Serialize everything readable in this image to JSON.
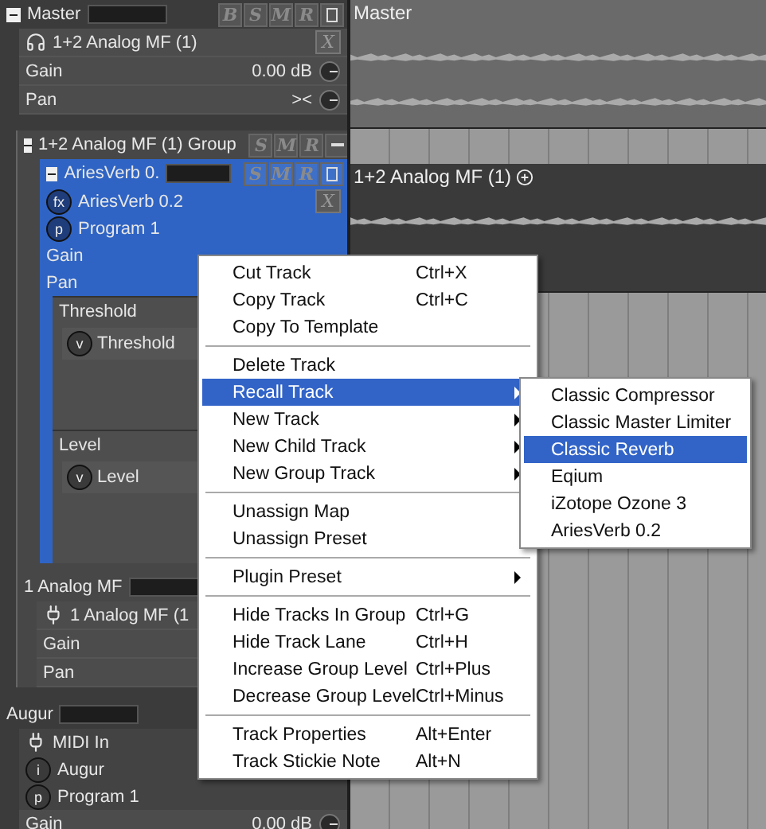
{
  "master": {
    "title": "Master",
    "buttons": [
      {
        "kind": "letter",
        "label": "B"
      },
      {
        "kind": "letter",
        "label": "S"
      },
      {
        "kind": "letter",
        "label": "M"
      },
      {
        "kind": "letter",
        "label": "R"
      },
      {
        "kind": "square"
      }
    ],
    "input": "1+2 Analog MF (1)",
    "remove": "X",
    "gain_label": "Gain",
    "gain_value": "0.00 dB",
    "pan_label": "Pan",
    "pan_value": "><"
  },
  "group": {
    "title": "1+2 Analog MF (1) Group",
    "buttons": [
      {
        "kind": "letter",
        "label": "S"
      },
      {
        "kind": "letter",
        "label": "M"
      },
      {
        "kind": "letter",
        "label": "R"
      },
      {
        "kind": "minus"
      }
    ],
    "selected_track": {
      "title": "AriesVerb 0.",
      "buttons": [
        {
          "kind": "letter",
          "label": "S"
        },
        {
          "kind": "letter",
          "label": "M"
        },
        {
          "kind": "letter",
          "label": "R"
        },
        {
          "kind": "square"
        }
      ],
      "plugin_badge": "fx",
      "plugin": "AriesVerb 0.2",
      "remove": "X",
      "program_badge": "p",
      "program": "Program 1",
      "gain_label": "Gain",
      "pan_label": "Pan",
      "params": [
        {
          "header": "Threshold",
          "badge": "v",
          "control": "Threshold"
        },
        {
          "header": "Level",
          "badge": "v",
          "control": "Level"
        }
      ]
    },
    "track": {
      "title": "1 Analog MF",
      "input": "1 Analog MF (1",
      "gain_label": "Gain",
      "pan_label": "Pan"
    }
  },
  "augur": {
    "title": "Augur",
    "input": "MIDI In",
    "instrument_badge": "i",
    "instrument": "Augur",
    "program_badge": "p",
    "program": "Program 1",
    "gain_label": "Gain",
    "gain_value": "0.00 dB"
  },
  "timeline": {
    "lanes": [
      {
        "label": "Master"
      },
      {
        "label": "1+2 Analog MF (1)"
      }
    ]
  },
  "context_menu": {
    "groups": [
      [
        {
          "label": "Cut Track",
          "shortcut": "Ctrl+X",
          "submenu": false,
          "selected": false
        },
        {
          "label": "Copy Track",
          "shortcut": "Ctrl+C",
          "submenu": false,
          "selected": false
        },
        {
          "label": "Copy To Template",
          "submenu": false,
          "selected": false
        }
      ],
      [
        {
          "label": "Delete Track",
          "submenu": false,
          "selected": false
        },
        {
          "label": "Recall Track",
          "submenu": true,
          "selected": true
        },
        {
          "label": "New Track",
          "submenu": true,
          "selected": false
        },
        {
          "label": "New Child Track",
          "submenu": true,
          "selected": false
        },
        {
          "label": "New Group Track",
          "submenu": true,
          "selected": false
        }
      ],
      [
        {
          "label": "Unassign Map",
          "submenu": false,
          "selected": false
        },
        {
          "label": "Unassign Preset",
          "submenu": false,
          "selected": false
        }
      ],
      [
        {
          "label": "Plugin Preset",
          "submenu": true,
          "selected": false
        }
      ],
      [
        {
          "label": "Hide Tracks In Group",
          "shortcut": "Ctrl+G",
          "submenu": false,
          "selected": false
        },
        {
          "label": "Hide Track Lane",
          "shortcut": "Ctrl+H",
          "submenu": false,
          "selected": false
        },
        {
          "label": "Increase Group Level",
          "shortcut": "Ctrl+Plus",
          "submenu": false,
          "selected": false
        },
        {
          "label": "Decrease Group Level",
          "shortcut": "Ctrl+Minus",
          "submenu": false,
          "selected": false
        }
      ],
      [
        {
          "label": "Track Properties",
          "shortcut": "Alt+Enter",
          "submenu": false,
          "selected": false
        },
        {
          "label": "Track Stickie Note",
          "shortcut": "Alt+N",
          "submenu": false,
          "selected": false
        }
      ]
    ]
  },
  "submenu": {
    "items": [
      {
        "label": "Classic Compressor",
        "selected": false
      },
      {
        "label": "Classic Master Limiter",
        "selected": false
      },
      {
        "label": "Classic Reverb",
        "selected": true
      },
      {
        "label": "Eqium",
        "selected": false
      },
      {
        "label": "iZotope Ozone 3",
        "selected": false
      },
      {
        "label": "AriesVerb 0.2",
        "selected": false
      }
    ]
  }
}
